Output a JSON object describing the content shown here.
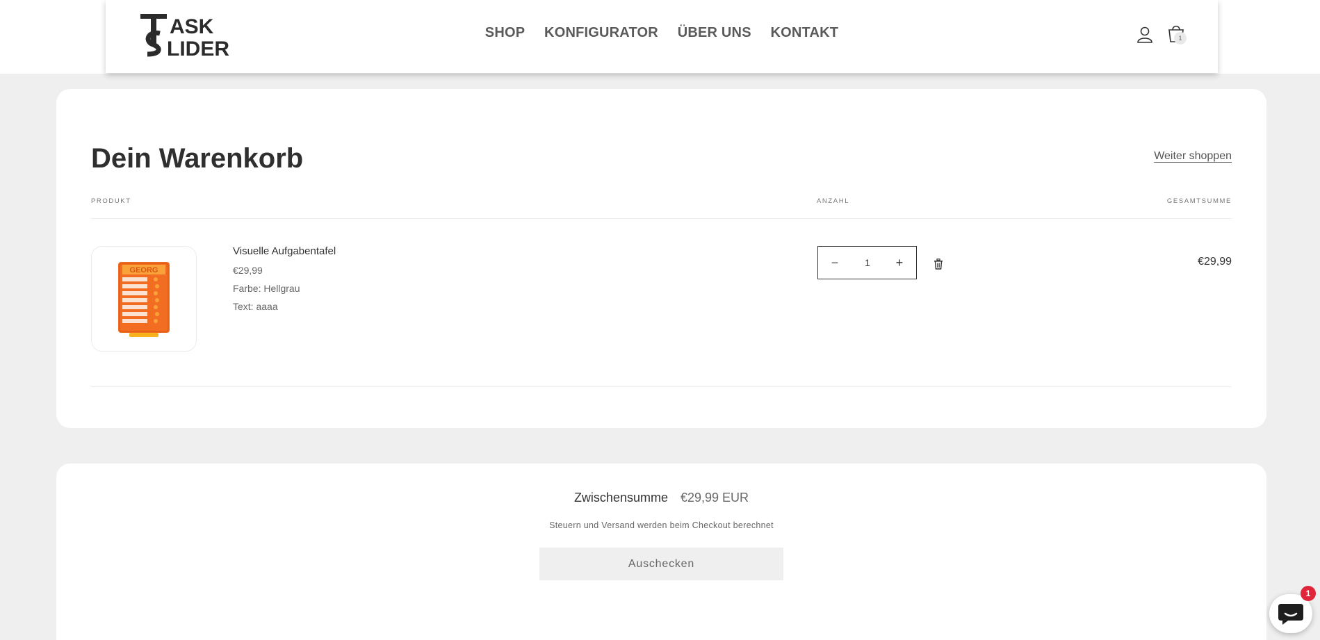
{
  "header": {
    "logo_name": "TaskSlider",
    "nav": [
      "SHOP",
      "KONFIGURATOR",
      "ÜBER UNS",
      "KONTAKT"
    ],
    "cart_count": "1",
    "icons": [
      "user-icon",
      "shopping-bag-icon"
    ]
  },
  "cart": {
    "title": "Dein Warenkorb",
    "continue_label": "Weiter shoppen",
    "columns": {
      "product": "PRODUKT",
      "quantity": "ANZAHL",
      "total": "GESAMTSUMME"
    },
    "item": {
      "name": "Visuelle Aufgabentafel",
      "price": "€29,99",
      "color": "Farbe: Hellgrau",
      "text": "Text: aaaa",
      "quantity": "1",
      "total": "€29,99",
      "image_label": "GEORG"
    }
  },
  "summary": {
    "subtotal_label": "Zwischensumme",
    "subtotal_amount": "€29,99 EUR",
    "tax_note": "Steuern und Versand werden beim Checkout berechnet",
    "checkout_label": "Auschecken"
  },
  "chat": {
    "badge": "1"
  },
  "colors": {
    "page_bg": "#efefef",
    "accent_orange": "#f26d21",
    "chat_badge": "#e0263a"
  }
}
